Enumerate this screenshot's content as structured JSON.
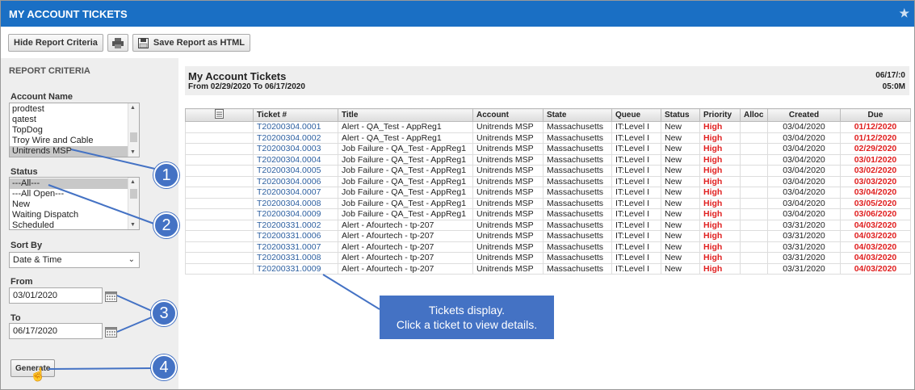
{
  "window": {
    "title": "MY ACCOUNT TICKETS",
    "star_icon": "star-icon"
  },
  "toolbar": {
    "hide_label": "Hide Report Criteria",
    "save_label": "Save Report as HTML"
  },
  "criteria": {
    "heading": "REPORT CRITERIA",
    "account_label": "Account Name",
    "accounts": [
      "prodtest",
      "qatest",
      "TopDog",
      "Troy Wire and Cable",
      "Unitrends MSP"
    ],
    "status_label": "Status",
    "statuses": [
      "---All---",
      "---All Open---",
      "New",
      "Waiting Dispatch",
      "Scheduled"
    ],
    "sort_label": "Sort By",
    "sort_value": "Date & Time",
    "from_label": "From",
    "from_value": "03/01/2020",
    "to_label": "To",
    "to_value": "06/17/2020",
    "generate_label": "Generate"
  },
  "report": {
    "title": "My Account Tickets",
    "range": "From 02/29/2020 To 06/17/2020",
    "date": "06/17/:0",
    "time": "05:0M"
  },
  "table": {
    "headers": [
      "",
      "Ticket #",
      "Title",
      "Account",
      "State",
      "Queue",
      "Status",
      "Priority",
      "Alloc",
      "Created",
      "Due"
    ],
    "rows": [
      [
        "T20200304.0001",
        "Alert - QA_Test - AppReg1",
        "Unitrends MSP",
        "Massachusetts",
        "IT:Level I",
        "New",
        "High",
        "",
        "03/04/2020",
        "01/12/2020"
      ],
      [
        "T20200304.0002",
        "Alert - QA_Test - AppReg1",
        "Unitrends MSP",
        "Massachusetts",
        "IT:Level I",
        "New",
        "High",
        "",
        "03/04/2020",
        "01/12/2020"
      ],
      [
        "T20200304.0003",
        "Job Failure - QA_Test - AppReg1",
        "Unitrends MSP",
        "Massachusetts",
        "IT:Level I",
        "New",
        "High",
        "",
        "03/04/2020",
        "02/29/2020"
      ],
      [
        "T20200304.0004",
        "Job Failure - QA_Test - AppReg1",
        "Unitrends MSP",
        "Massachusetts",
        "IT:Level I",
        "New",
        "High",
        "",
        "03/04/2020",
        "03/01/2020"
      ],
      [
        "T20200304.0005",
        "Job Failure - QA_Test - AppReg1",
        "Unitrends MSP",
        "Massachusetts",
        "IT:Level I",
        "New",
        "High",
        "",
        "03/04/2020",
        "03/02/2020"
      ],
      [
        "T20200304.0006",
        "Job Failure - QA_Test - AppReg1",
        "Unitrends MSP",
        "Massachusetts",
        "IT:Level I",
        "New",
        "High",
        "",
        "03/04/2020",
        "03/03/2020"
      ],
      [
        "T20200304.0007",
        "Job Failure - QA_Test - AppReg1",
        "Unitrends MSP",
        "Massachusetts",
        "IT:Level I",
        "New",
        "High",
        "",
        "03/04/2020",
        "03/04/2020"
      ],
      [
        "T20200304.0008",
        "Job Failure - QA_Test - AppReg1",
        "Unitrends MSP",
        "Massachusetts",
        "IT:Level I",
        "New",
        "High",
        "",
        "03/04/2020",
        "03/05/2020"
      ],
      [
        "T20200304.0009",
        "Job Failure - QA_Test - AppReg1",
        "Unitrends MSP",
        "Massachusetts",
        "IT:Level I",
        "New",
        "High",
        "",
        "03/04/2020",
        "03/06/2020"
      ],
      [
        "T20200331.0002",
        "Alert - Afourtech - tp-207",
        "Unitrends MSP",
        "Massachusetts",
        "IT:Level I",
        "New",
        "High",
        "",
        "03/31/2020",
        "04/03/2020"
      ],
      [
        "T20200331.0006",
        "Alert - Afourtech - tp-207",
        "Unitrends MSP",
        "Massachusetts",
        "IT:Level I",
        "New",
        "High",
        "",
        "03/31/2020",
        "04/03/2020"
      ],
      [
        "T20200331.0007",
        "Alert - Afourtech - tp-207",
        "Unitrends MSP",
        "Massachusetts",
        "IT:Level I",
        "New",
        "High",
        "",
        "03/31/2020",
        "04/03/2020"
      ],
      [
        "T20200331.0008",
        "Alert - Afourtech - tp-207",
        "Unitrends MSP",
        "Massachusetts",
        "IT:Level I",
        "New",
        "High",
        "",
        "03/31/2020",
        "04/03/2020"
      ],
      [
        "T20200331.0009",
        "Alert - Afourtech - tp-207",
        "Unitrends MSP",
        "Massachusetts",
        "IT:Level I",
        "New",
        "High",
        "",
        "03/31/2020",
        "04/03/2020"
      ]
    ]
  },
  "callouts": {
    "badges": [
      "1",
      "2",
      "3",
      "4"
    ],
    "tip_line1": "Tickets display.",
    "tip_line2": "Click a ticket to view details."
  },
  "colors": {
    "title_bar": "#1a6fc4",
    "callout": "#4472c4",
    "priority_high": "#e02020",
    "link": "#2c5fa0"
  }
}
